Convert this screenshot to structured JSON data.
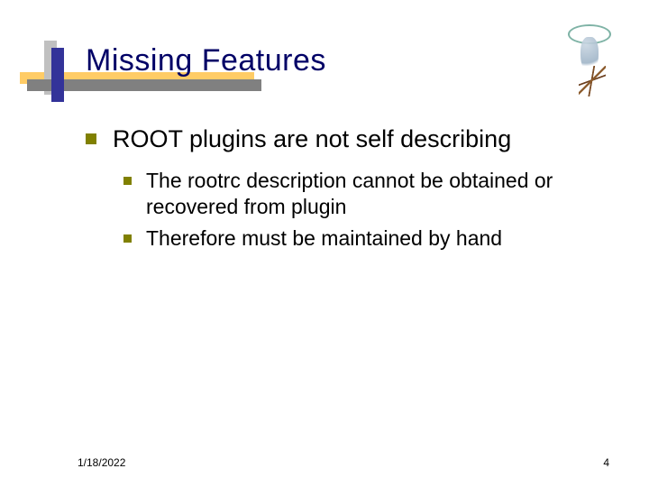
{
  "title": "Missing Features",
  "bullets": {
    "lvl1_0": "ROOT plugins are not self describing",
    "lvl2_0": "The rootrc description cannot be obtained or recovered from plugin",
    "lvl2_1": "Therefore must be maintained by hand"
  },
  "footer": {
    "date": "1/18/2022",
    "page": "4"
  }
}
